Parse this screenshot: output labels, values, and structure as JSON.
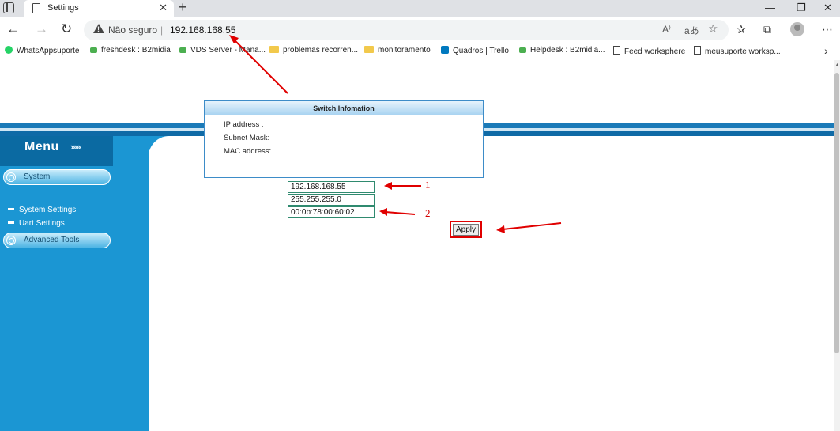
{
  "browser": {
    "tab_title": "Settings",
    "tab_close": "✕",
    "new_tab": "+",
    "win_min": "—",
    "win_max": "❐",
    "win_close": "✕",
    "nav": {
      "back": "←",
      "forward": "→",
      "reload": "↻"
    },
    "address": {
      "security_label": "Não seguro",
      "separator": "|",
      "url": "192.168.168.55"
    },
    "toolbar_glyphs": {
      "read_aloud": "A⁾",
      "translate": "aあ",
      "favorite": "☆",
      "favorites": "✰",
      "collections": "⧉",
      "more": "⋯"
    },
    "bookmarks": [
      {
        "label": "WhatsAppsuporte",
        "icon": "whatsapp-icon"
      },
      {
        "label": "freshdesk : B2midia",
        "icon": "freshdesk-icon"
      },
      {
        "label": "VDS Server - Mana...",
        "icon": "freshdesk-icon"
      },
      {
        "label": "problemas recorren...",
        "icon": "folder-icon"
      },
      {
        "label": "monitoramento",
        "icon": "folder-icon"
      },
      {
        "label": "Quadros | Trello",
        "icon": "trello-icon"
      },
      {
        "label": "Helpdesk : B2midia...",
        "icon": "freshdesk-icon"
      },
      {
        "label": "Feed worksphere",
        "icon": "page-icon"
      },
      {
        "label": "meusuporte worksp...",
        "icon": "page-icon"
      }
    ],
    "bookmarks_more": "›"
  },
  "sidebar": {
    "menu_title": "Menu",
    "menu_chevrons": "›››››",
    "system_label": "System",
    "items": [
      {
        "label": "System Settings"
      },
      {
        "label": "Uart Settings"
      }
    ],
    "advanced_label": "Advanced Tools"
  },
  "panel": {
    "title": "Switch Infomation",
    "fields": [
      {
        "label": "IP address :",
        "value": "192.168.168.55"
      },
      {
        "label": "Subnet Mask:",
        "value": "255.255.255.0"
      },
      {
        "label": "MAC address:",
        "value": "00:0b:78:00:60:02"
      }
    ],
    "apply_label": "Apply"
  },
  "annotations": {
    "marker_1": "1",
    "marker_2": "2"
  },
  "colors": {
    "sidebar_blue": "#1b96d3",
    "header_blue": "#0b6aa2",
    "panel_border": "#3d8cc8",
    "annotation_red": "#e00000"
  }
}
